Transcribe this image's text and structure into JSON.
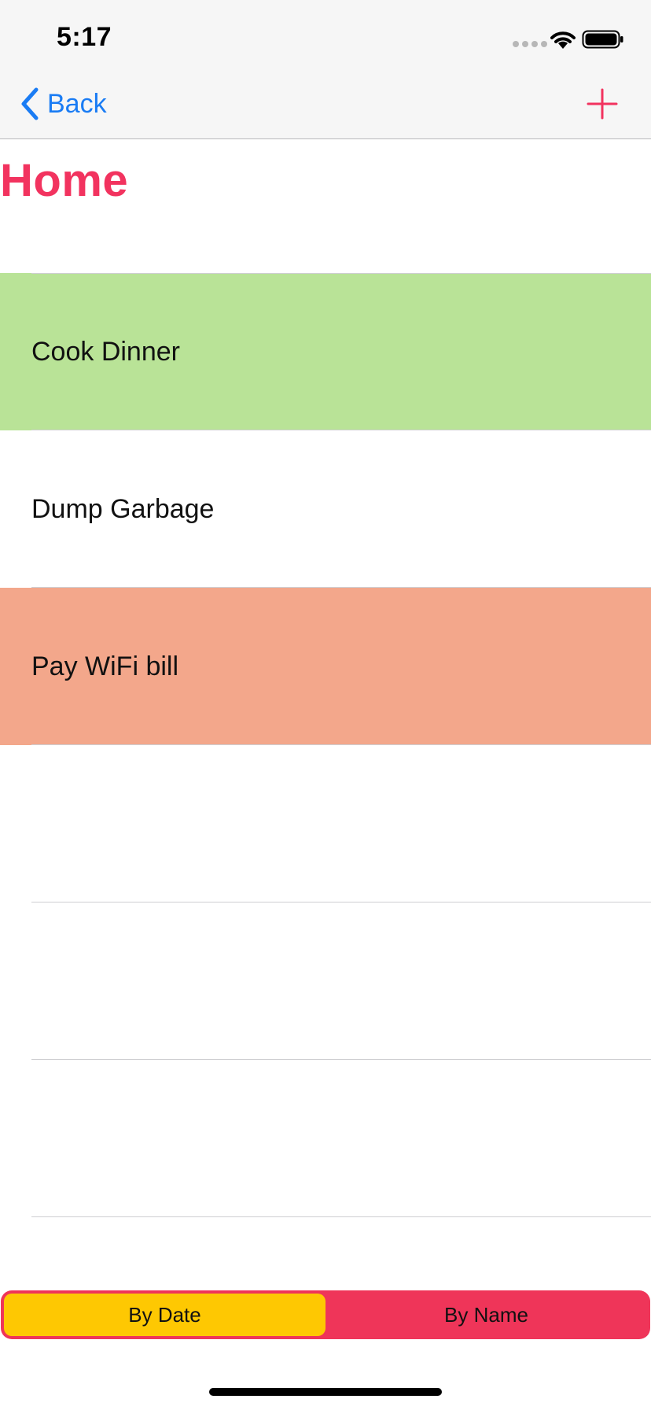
{
  "status_bar": {
    "time": "5:17",
    "icons": [
      "signal-dots-icon",
      "wifi-icon",
      "battery-icon"
    ]
  },
  "nav": {
    "back_label": "Back",
    "back_icon": "chevron-left-icon",
    "add_icon": "plus-icon"
  },
  "page": {
    "title": "Home"
  },
  "colors": {
    "accent_pink": "#f2335f",
    "link_blue": "#1a7cf4",
    "row_green": "#b9e397",
    "row_salmon": "#f3a78b",
    "segment_bg": "#ef3559",
    "segment_selected": "#fec802"
  },
  "tasks": [
    {
      "label": "Cook Dinner",
      "color": "#b9e397"
    },
    {
      "label": "Dump Garbage",
      "color": "#ffffff"
    },
    {
      "label": "Pay WiFi bill",
      "color": "#f3a78b"
    },
    {
      "label": "",
      "color": "#ffffff"
    },
    {
      "label": "",
      "color": "#ffffff"
    },
    {
      "label": "",
      "color": "#ffffff"
    }
  ],
  "sort_control": {
    "options": [
      "By Date",
      "By Name"
    ],
    "selected": "By Date"
  }
}
